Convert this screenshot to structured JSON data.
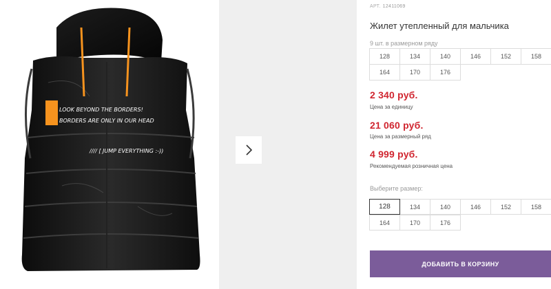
{
  "gallery": {
    "print_line1": "LOOK BEYOND THE BORDERS!",
    "print_line2": "BORDERS ARE ONLY IN OUR HEAD",
    "print_line3": "//// [ JUMP EVERYTHING :-))",
    "next_icon": "chevron-right-icon",
    "accent_orange": "#f7931e"
  },
  "product": {
    "article_label": "АРТ.",
    "article_number": "12411069",
    "title": "Жилет утепленный для мальчика",
    "size_row_hint": "9 шт. в размерном ряду",
    "size_row": [
      "128",
      "134",
      "140",
      "146",
      "152",
      "158",
      "164",
      "170",
      "176"
    ]
  },
  "prices": {
    "unit_price": "2 340 руб.",
    "unit_label": "Цена за единицу",
    "row_price": "21 060 руб.",
    "row_label": "Цена за размерный ряд",
    "retail_price": "4 999 руб.",
    "retail_label": "Рекомендуемая розничная цена",
    "price_color": "#d0252f"
  },
  "size_select": {
    "label": "Выберите размер:",
    "selected": "128",
    "options": [
      "128",
      "134",
      "140",
      "146",
      "152",
      "158",
      "164",
      "170",
      "176"
    ]
  },
  "cart": {
    "button_label": "ДОБАВИТЬ В КОРЗИНУ",
    "button_color": "#7b5c9a"
  }
}
